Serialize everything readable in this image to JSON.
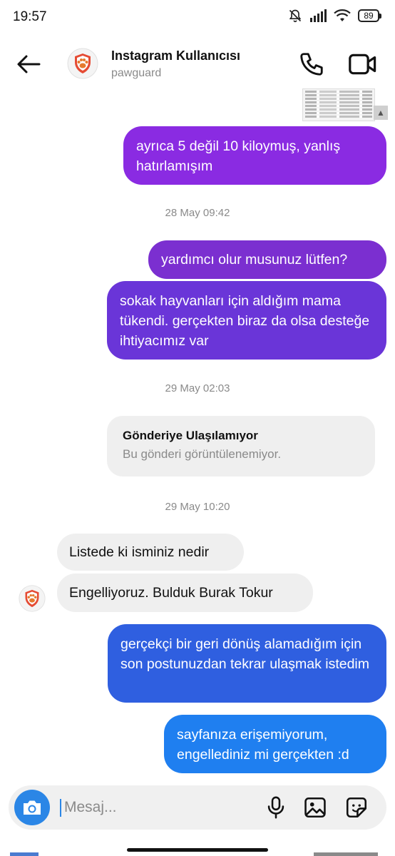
{
  "status_bar": {
    "time": "19:57",
    "battery": "89",
    "icons": [
      "mute-bell-icon",
      "signal-icon",
      "wifi-icon",
      "battery-icon"
    ]
  },
  "header": {
    "name": "Instagram Kullanıcısı",
    "username": "pawguard",
    "icons": [
      "back-arrow-icon",
      "paw-shield-avatar",
      "phone-icon",
      "video-camera-icon"
    ]
  },
  "messages": [
    {
      "id": "m1",
      "direction": "outgoing",
      "text": "ayrıca 5 değil 10 kiloymuş, yanlış hatırlamışım",
      "color": "#8a2be2"
    },
    {
      "id": "ts1",
      "type": "timestamp",
      "text": "28 May 09:42"
    },
    {
      "id": "m2",
      "direction": "outgoing",
      "text": "yardımcı olur musunuz lütfen?",
      "color": "#7b2fd0"
    },
    {
      "id": "m3",
      "direction": "outgoing",
      "text": "sokak hayvanları için aldığım mama tükendi. gerçekten biraz da olsa desteğe ihtiyacımız var",
      "color": "#6a35d8"
    },
    {
      "id": "ts2",
      "type": "timestamp",
      "text": "29 May 02:03"
    },
    {
      "id": "m4",
      "direction": "outgoing",
      "type": "unavailable_post",
      "title": "Gönderiye Ulaşılamıyor",
      "subtitle": "Bu gönderi görüntülenemiyor."
    },
    {
      "id": "ts3",
      "type": "timestamp",
      "text": "29 May 10:20"
    },
    {
      "id": "m5",
      "direction": "incoming",
      "text": "Listede ki isminiz nedir"
    },
    {
      "id": "m6",
      "direction": "incoming",
      "text": "Engelliyoruz. Bulduk Burak Tokur"
    },
    {
      "id": "m7",
      "direction": "outgoing",
      "text": "gerçekçi bir geri dönüş alamadığım için son postunuzdan tekrar ulaşmak istedim",
      "color": "#2f5fe0"
    },
    {
      "id": "m8",
      "direction": "outgoing",
      "text": "sayfanıza erişemiyorum, engellediniz mi gerçekten :d",
      "color": "#1f7ff0"
    }
  ],
  "composer": {
    "placeholder": "Mesaj...",
    "icons": [
      "camera-icon",
      "microphone-icon",
      "gallery-icon",
      "sticker-icon"
    ]
  }
}
